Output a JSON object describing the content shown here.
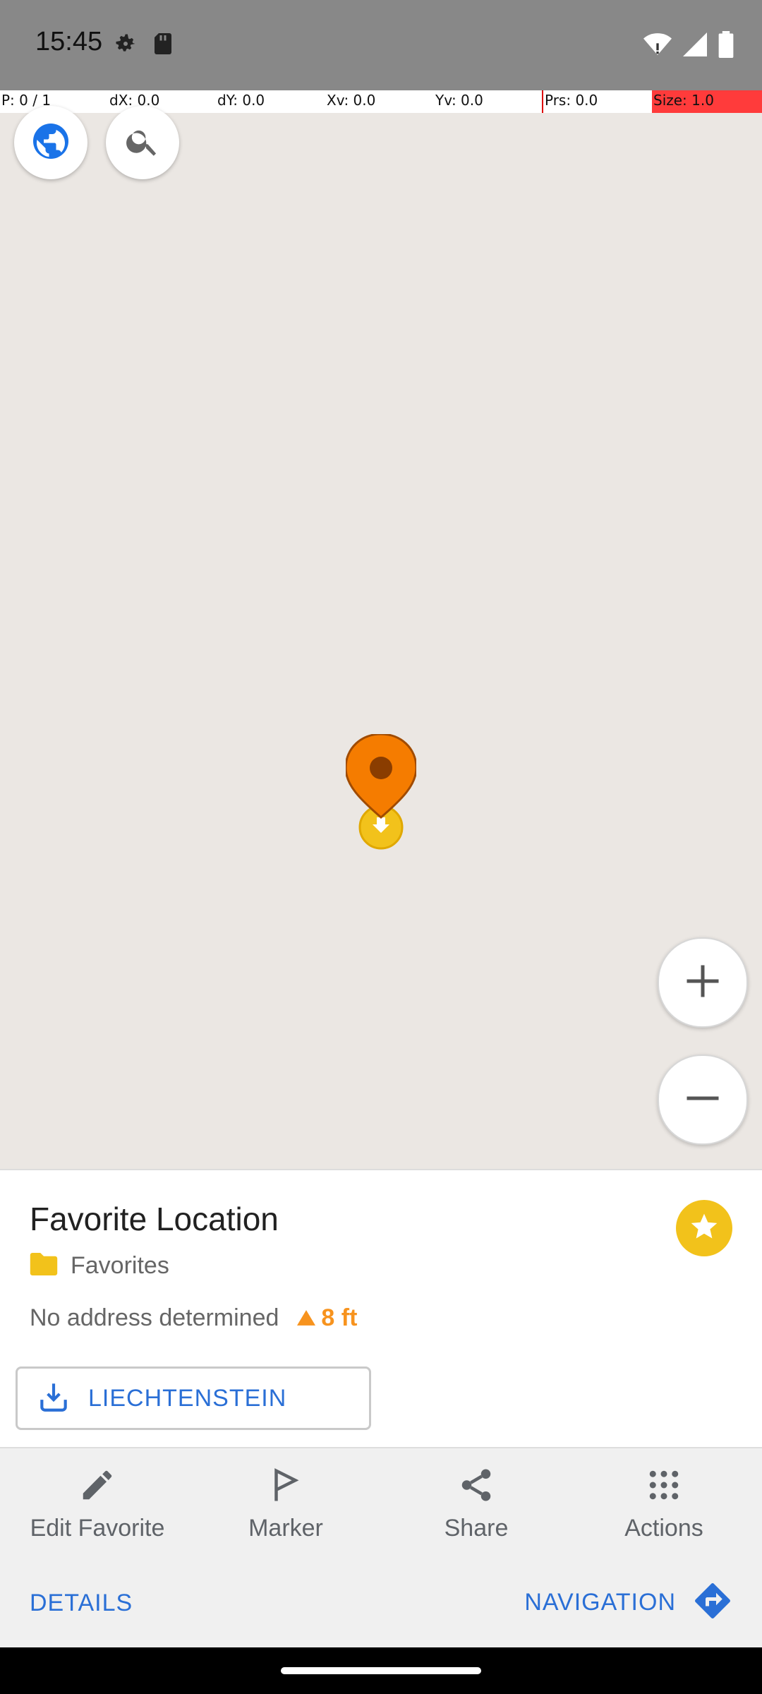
{
  "status": {
    "time": "15:45"
  },
  "debug": {
    "p": "P: 0 / 1",
    "dx": "dX: 0.0",
    "dy": "dY: 0.0",
    "xv": "Xv: 0.0",
    "yv": "Yv: 0.0",
    "prs": "Prs: 0.0",
    "size": "Size: 1.0"
  },
  "map_controls": {
    "layers_icon": "globe-icon",
    "search_icon": "search-icon",
    "zoom_in_icon": "plus-icon",
    "zoom_out_icon": "minus-icon"
  },
  "info": {
    "title": "Favorite Location",
    "folder": "Favorites",
    "address": "No address determined",
    "elevation": "8 ft",
    "download_label": "LIECHTENSTEIN"
  },
  "actions": {
    "edit": "Edit Favorite",
    "marker": "Marker",
    "share": "Share",
    "more": "Actions"
  },
  "bottom": {
    "details": "DETAILS",
    "navigation": "NAVIGATION"
  },
  "colors": {
    "accent_blue": "#2a6fd6",
    "pin_orange": "#f7931e",
    "star_yellow": "#f2c21b",
    "map_bg": "#ebe7e3"
  }
}
